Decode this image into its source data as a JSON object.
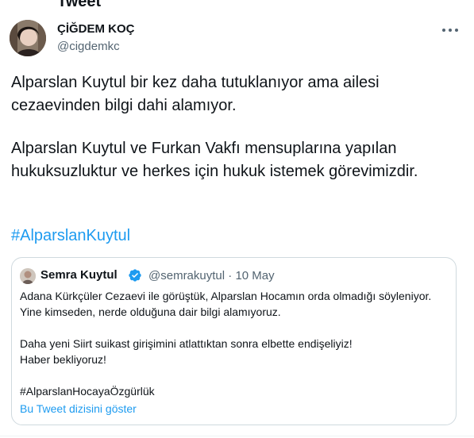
{
  "header": {
    "title_partial": "Tweet"
  },
  "author": {
    "name": "ÇİĞDEM KOÇ",
    "handle": "@cigdemkc"
  },
  "tweet": {
    "paragraph_1": "Alparslan Kuytul bir kez daha tutuklanıyor ama ailesi cezaevinden bilgi dahi alamıyor.",
    "paragraph_2": "Alparslan Kuytul ve Furkan Vakfı mensuplarına yapılan hukuksuzluktur ve herkes için hukuk istemek görevimizdir.",
    "hashtag": "#AlparslanKuytul"
  },
  "quoted_tweet": {
    "name": "Semra Kuytul",
    "handle": "@semrakuytul",
    "separator": "·",
    "date": "10 May",
    "line_1": "Adana Kürkçüler Cezaevi ile görüştük, Alparslan Hocamın orda olmadığı söyleniyor. Yine kimseden, nerde olduğuna dair bilgi alamıyoruz.",
    "line_2": "Daha yeni Siirt suikast girişimini atlattıktan sonra elbette endişeliyiz!",
    "line_3": "Haber bekliyoruz!",
    "hashtag": "#AlparslanHocayaÖzgürlük",
    "show_thread": "Bu Tweet dizisini göster"
  },
  "colors": {
    "accent": "#1d9bf0",
    "text": "#0f1419",
    "secondary": "#536471",
    "border": "#cfd9de"
  },
  "icons": [
    "more-icon",
    "verified-badge-icon"
  ]
}
